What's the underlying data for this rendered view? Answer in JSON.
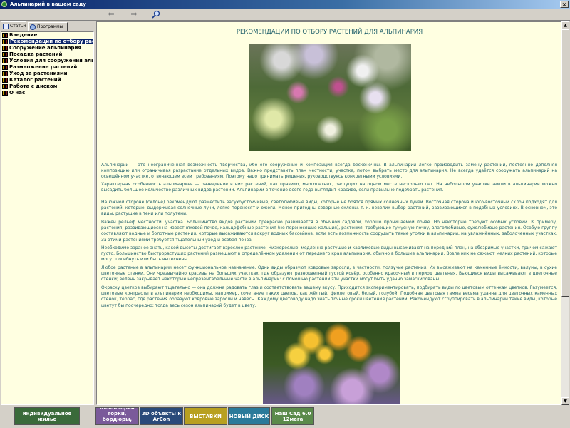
{
  "window": {
    "title": "Альпинарий в вашем саду",
    "close_label": "×"
  },
  "toolbar": {
    "back": "⇐",
    "forward": "⇒"
  },
  "tabs": [
    {
      "label": "Статьи",
      "icon": "book-icon"
    },
    {
      "label": "Программы",
      "icon": "disk-icon"
    }
  ],
  "tree": [
    "Введение",
    "Рекомендации по отбору растений для альпинария",
    "Сооружение альпинария",
    "Посадка растений",
    "Условия для сооружения альпинария",
    "Размножение растений",
    "Уход за растениями",
    "Каталог растений",
    "Работа с диском",
    "О нас"
  ],
  "selected_index": 1,
  "article": {
    "title": "РЕКОМЕНДАЦИИ ПО ОТБОРУ РАСТЕНИЙ ДЛЯ АЛЬПИНАРИЯ",
    "paragraphs": [
      "Альпинарий — это неограниченная возможность творчества, ибо его сооружение и композиция всегда бесконечны. В альпинарии легко производить замену растений, постоянно дополняя композицию или ограничивая разрастание отдельных видов. Важно представить план местности, участка, потом выбрать место для альпинария. Не всегда удаётся сооружать альпинарий на освещённом участке, отвечающем всем требованиям. Поэтому надо принимать решения, руководствуясь конкретными условиями.",
      "Характерная особенность альпинариев — разведение в них растений, как правило, многолетних, растущих на одном месте несколько лет. На небольшом участке земли в альпинарии можно высадить большое количество различных видов растений. Альпинарий в течение всего года выглядит красиво, если правильно подобрать растения.",
      "На южной стороне (склоне) рекомендуют разместить засухоустойчивые, светолюбивые виды, которые не боятся прямых солнечных лучей. Восточная сторона и юго-восточный склон подходят для растений, которые, выдерживая солнечные лучи, легко переносят и ожоги. Менее пригодны северные склоны, т. к. невелик выбор растений, развивающихся в подобных условиях. В основном, это виды, растущие в тени или полутени.",
      "Важен рельеф местности, участка. Большинство видов растений прекрасно развивается в обычной садовой, хорошо проницаемой почве. Но некоторые требуют особых условий. К примеру, растения, развивающиеся на известняковой почве, кальцефобные растения (не переносящие кальция), растения, требующие гумусную почву, влаголюбивые, сухолюбивые растения. Особую группу составляют водные и болотные растения, которые высаживаются вокруг водных бассейнов, если есть возможность соорудить такие уголки в альпинарии, на увлажнённых, заболоченных участках. За этими растениями требуется тщательный уход и особая почва.",
      "Необходимо заранее знать, какой высоты достигает взрослое растение. Низкорослые, медленно растущие и карликовые виды высаживают на передний план, на обозримые участки, причем сажают густо. Большинство быстрорастущих растений размещают в определённом удалении от переднего края альпинария, обычно в большие альпинарии. Возле них не сажают мелких растений, которые могут погибнуть или быть вытеснены.",
      "Любое растение в альпинарии несет функциональное назначение. Одни виды образуют ковровые заросли, в частности, ползучие растения. Их высаживают на каменные ёмкости, валуны, в сухие цветочные стенки. Они чрезвычайно красивы на больших участках, где образуют разноцветный густой ковёр, особенно красочный в период цветения. Вьющиеся виды высаживают в цветочные стенки; зелень закрывает некоторые непрезентабельные части в альпинарии: с помощью растений эти участки могут быть удачно замаскированы.",
      "Окраску цветков выбирают тщательно — она должна радовать глаз и соответствовать вашему вкусу. Приходится экспериментировать, подбирать виды по цветовым оттенкам цветков. Разумеется, цветовые контрасты в альпинарии необходимы, например, сочетание таких цветов, как жёлтый, фиолетовый, белый, голубой. Подобная цветовая гамма весьма удачна для цветочных каменных стенок, террас, где растения образуют ковровые заросли и навесы. Каждому цветоводу надо знать точные сроки цветения растений. Рекомендуют сгруппировать в альпинарии такие виды, которые цветут бы поочередно; тогда весь сезон альпинарий будет в цвету."
    ]
  },
  "banners": [
    {
      "text": "индивидуальное жилье",
      "bg": "#3a6a3a"
    },
    {
      "text": "альпинарии горки, бордюры, водоемы",
      "bg": "#7a5a9a"
    },
    {
      "text": "3D объекты к ArCon",
      "bg": "#2a4a7a"
    },
    {
      "text": "ВЫСТАВКИ",
      "bg": "#b8a020"
    },
    {
      "text": "НОВЫЙ ДИСК",
      "bg": "#2a7a9a"
    },
    {
      "text": "Наш Сад 6.0 12мега",
      "bg": "#5a8a4a"
    }
  ]
}
